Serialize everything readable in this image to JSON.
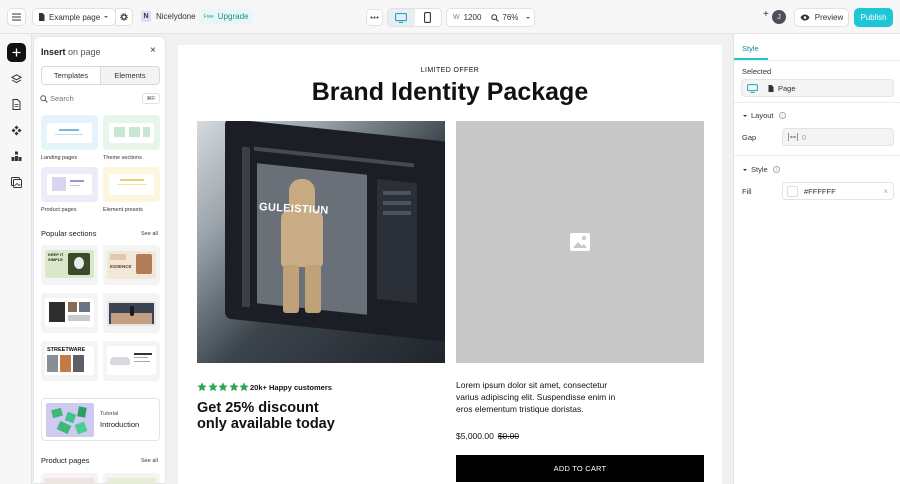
{
  "topbar": {
    "page_selector": "Example page",
    "workspace_initial": "N",
    "workspace_name": "Nicelydone",
    "free_badge": "Free",
    "upgrade_label": "Upgrade",
    "width_prefix": "W",
    "width_value": "1200",
    "zoom": "76%",
    "avatar_initial": "J",
    "preview_label": "Preview",
    "publish_label": "Publish"
  },
  "insert_panel": {
    "title_bold": "Insert",
    "title_rest": "on page",
    "tabs": [
      "Templates",
      "Elements"
    ],
    "search_placeholder": "Search",
    "search_shortcut": "⌘F",
    "categories": [
      "Landing pages",
      "Theme sections",
      "Product pages",
      "Element presets"
    ],
    "popular_heading": "Popular sections",
    "see_all": "See all",
    "popular_texts": [
      "KEEP IT SIMPLE",
      "ESSENCE",
      "STREETWARE"
    ],
    "tutorial_small": "Tutorial",
    "tutorial_title": "Introduction",
    "product_heading": "Product pages"
  },
  "canvas": {
    "eyebrow": "LIMITED OFFER",
    "headline": "Brand Identity Package",
    "image_brand_text": "GULEISTIUN",
    "rating_text": "20k+ Happy customers",
    "stars": 5,
    "discount_line1": "Get 25% discount",
    "discount_line2": "only available today",
    "body_text": "Lorem ipsum dolor sit amet, consectetur varius adipiscing elit. Suspendisse enim in eros elementum tristique doristas.",
    "price": "$5,000.00",
    "compare_price": "$0.00",
    "cta": "ADD TO CART"
  },
  "right_panel": {
    "tab": "Style",
    "selected_label": "Selected",
    "selected_item": "Page",
    "layout_label": "Layout",
    "gap_label": "Gap",
    "gap_value": "0",
    "style_label": "Style",
    "fill_label": "Fill",
    "fill_value": "#FFFFFF"
  },
  "colors": {
    "accent": "#1fc6d6",
    "star": "#2ea84f",
    "cta_bg": "#000000"
  }
}
